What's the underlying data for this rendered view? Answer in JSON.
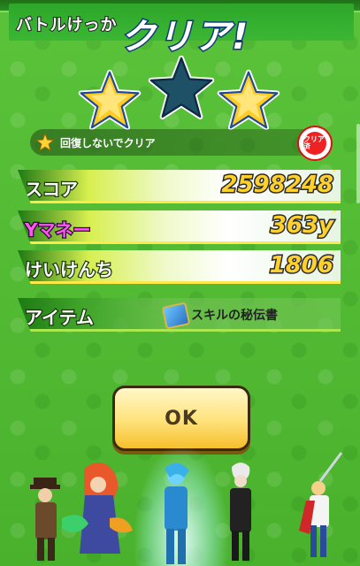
{
  "result": {
    "header_label": "バトルけっか",
    "title": "クリア!",
    "stars": {
      "earned": 2,
      "total": 3
    },
    "condition": {
      "text": "回復しないでクリア",
      "badge_text": "クリア済"
    }
  },
  "stats": [
    {
      "key": "score",
      "label": "スコア",
      "value": "2598248"
    },
    {
      "key": "money",
      "label": "Yマネー",
      "value": "363y"
    },
    {
      "key": "exp",
      "label": "けいけんち",
      "value": "1806"
    }
  ],
  "item": {
    "label": "アイテム",
    "name": "スキルの秘伝書"
  },
  "ok_button": {
    "label": "OK"
  },
  "colors": {
    "background": "#54bd35",
    "score_value": "#ffd12a",
    "money_label": "#ff55ee",
    "star_gold": "#ffd23a",
    "star_empty": "#1e5066"
  },
  "icons": {
    "star": "star-icon",
    "clear_badge": "clear-badge-icon",
    "item": "scroll-book-icon"
  }
}
